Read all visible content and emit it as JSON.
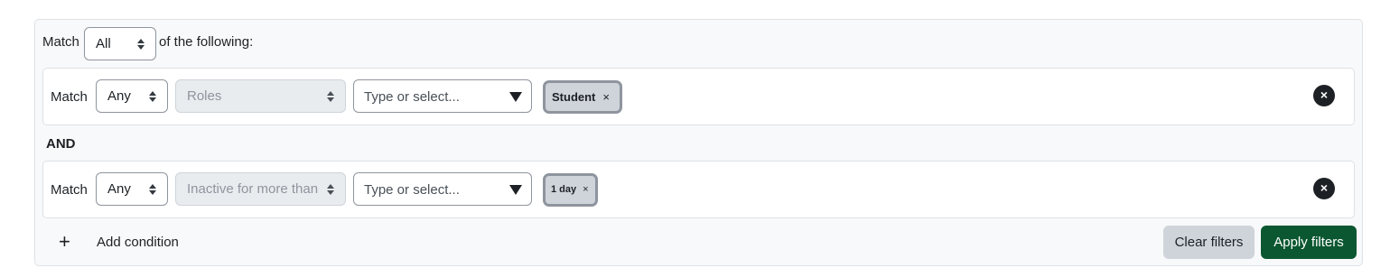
{
  "top": {
    "match_label": "Match",
    "match_value": "All",
    "suffix": "of the following:"
  },
  "conditions": [
    {
      "match_label": "Match",
      "match_value": "Any",
      "field": "Roles",
      "type_placeholder": "Type or select...",
      "chip": "Student",
      "chip_remove": "×",
      "remove": "×"
    },
    {
      "match_label": "Match",
      "match_value": "Any",
      "field": "Inactive for more than",
      "type_placeholder": "Type or select...",
      "chip": "1 day",
      "chip_remove": "×",
      "remove": "×"
    }
  ],
  "joiner": "AND",
  "footer": {
    "add_icon": "+",
    "add_label": "Add condition",
    "clear_label": "Clear filters",
    "apply_label": "Apply filters"
  },
  "colors": {
    "apply_bg": "#0b5731",
    "clear_bg": "#ced4da",
    "chip_bg": "#ced4da"
  },
  "icons": {
    "add": "plus-icon",
    "remove": "close-circle-icon",
    "dropdown": "caret-down-icon",
    "select": "updown-icon"
  }
}
